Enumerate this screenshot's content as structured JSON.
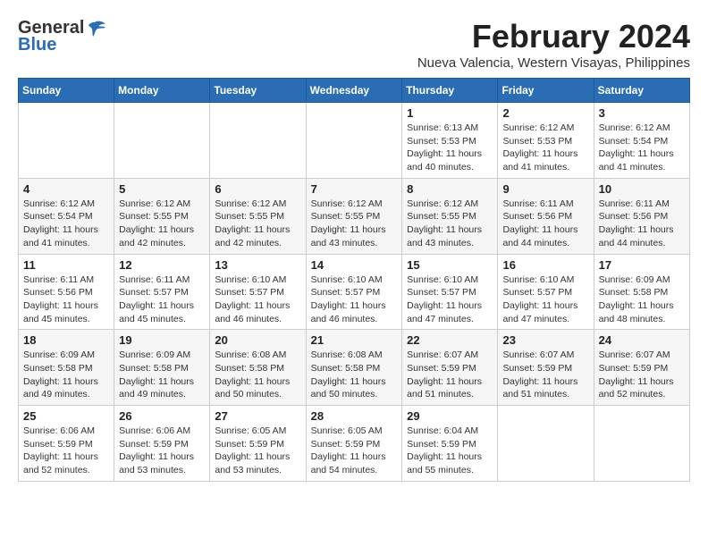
{
  "logo": {
    "general": "General",
    "blue": "Blue"
  },
  "header": {
    "month_year": "February 2024",
    "location": "Nueva Valencia, Western Visayas, Philippines"
  },
  "weekdays": [
    "Sunday",
    "Monday",
    "Tuesday",
    "Wednesday",
    "Thursday",
    "Friday",
    "Saturday"
  ],
  "weeks": [
    [
      {
        "day": "",
        "info": ""
      },
      {
        "day": "",
        "info": ""
      },
      {
        "day": "",
        "info": ""
      },
      {
        "day": "",
        "info": ""
      },
      {
        "day": "1",
        "info": "Sunrise: 6:13 AM\nSunset: 5:53 PM\nDaylight: 11 hours\nand 40 minutes."
      },
      {
        "day": "2",
        "info": "Sunrise: 6:12 AM\nSunset: 5:53 PM\nDaylight: 11 hours\nand 41 minutes."
      },
      {
        "day": "3",
        "info": "Sunrise: 6:12 AM\nSunset: 5:54 PM\nDaylight: 11 hours\nand 41 minutes."
      }
    ],
    [
      {
        "day": "4",
        "info": "Sunrise: 6:12 AM\nSunset: 5:54 PM\nDaylight: 11 hours\nand 41 minutes."
      },
      {
        "day": "5",
        "info": "Sunrise: 6:12 AM\nSunset: 5:55 PM\nDaylight: 11 hours\nand 42 minutes."
      },
      {
        "day": "6",
        "info": "Sunrise: 6:12 AM\nSunset: 5:55 PM\nDaylight: 11 hours\nand 42 minutes."
      },
      {
        "day": "7",
        "info": "Sunrise: 6:12 AM\nSunset: 5:55 PM\nDaylight: 11 hours\nand 43 minutes."
      },
      {
        "day": "8",
        "info": "Sunrise: 6:12 AM\nSunset: 5:55 PM\nDaylight: 11 hours\nand 43 minutes."
      },
      {
        "day": "9",
        "info": "Sunrise: 6:11 AM\nSunset: 5:56 PM\nDaylight: 11 hours\nand 44 minutes."
      },
      {
        "day": "10",
        "info": "Sunrise: 6:11 AM\nSunset: 5:56 PM\nDaylight: 11 hours\nand 44 minutes."
      }
    ],
    [
      {
        "day": "11",
        "info": "Sunrise: 6:11 AM\nSunset: 5:56 PM\nDaylight: 11 hours\nand 45 minutes."
      },
      {
        "day": "12",
        "info": "Sunrise: 6:11 AM\nSunset: 5:57 PM\nDaylight: 11 hours\nand 45 minutes."
      },
      {
        "day": "13",
        "info": "Sunrise: 6:10 AM\nSunset: 5:57 PM\nDaylight: 11 hours\nand 46 minutes."
      },
      {
        "day": "14",
        "info": "Sunrise: 6:10 AM\nSunset: 5:57 PM\nDaylight: 11 hours\nand 46 minutes."
      },
      {
        "day": "15",
        "info": "Sunrise: 6:10 AM\nSunset: 5:57 PM\nDaylight: 11 hours\nand 47 minutes."
      },
      {
        "day": "16",
        "info": "Sunrise: 6:10 AM\nSunset: 5:57 PM\nDaylight: 11 hours\nand 47 minutes."
      },
      {
        "day": "17",
        "info": "Sunrise: 6:09 AM\nSunset: 5:58 PM\nDaylight: 11 hours\nand 48 minutes."
      }
    ],
    [
      {
        "day": "18",
        "info": "Sunrise: 6:09 AM\nSunset: 5:58 PM\nDaylight: 11 hours\nand 49 minutes."
      },
      {
        "day": "19",
        "info": "Sunrise: 6:09 AM\nSunset: 5:58 PM\nDaylight: 11 hours\nand 49 minutes."
      },
      {
        "day": "20",
        "info": "Sunrise: 6:08 AM\nSunset: 5:58 PM\nDaylight: 11 hours\nand 50 minutes."
      },
      {
        "day": "21",
        "info": "Sunrise: 6:08 AM\nSunset: 5:58 PM\nDaylight: 11 hours\nand 50 minutes."
      },
      {
        "day": "22",
        "info": "Sunrise: 6:07 AM\nSunset: 5:59 PM\nDaylight: 11 hours\nand 51 minutes."
      },
      {
        "day": "23",
        "info": "Sunrise: 6:07 AM\nSunset: 5:59 PM\nDaylight: 11 hours\nand 51 minutes."
      },
      {
        "day": "24",
        "info": "Sunrise: 6:07 AM\nSunset: 5:59 PM\nDaylight: 11 hours\nand 52 minutes."
      }
    ],
    [
      {
        "day": "25",
        "info": "Sunrise: 6:06 AM\nSunset: 5:59 PM\nDaylight: 11 hours\nand 52 minutes."
      },
      {
        "day": "26",
        "info": "Sunrise: 6:06 AM\nSunset: 5:59 PM\nDaylight: 11 hours\nand 53 minutes."
      },
      {
        "day": "27",
        "info": "Sunrise: 6:05 AM\nSunset: 5:59 PM\nDaylight: 11 hours\nand 53 minutes."
      },
      {
        "day": "28",
        "info": "Sunrise: 6:05 AM\nSunset: 5:59 PM\nDaylight: 11 hours\nand 54 minutes."
      },
      {
        "day": "29",
        "info": "Sunrise: 6:04 AM\nSunset: 5:59 PM\nDaylight: 11 hours\nand 55 minutes."
      },
      {
        "day": "",
        "info": ""
      },
      {
        "day": "",
        "info": ""
      }
    ]
  ]
}
